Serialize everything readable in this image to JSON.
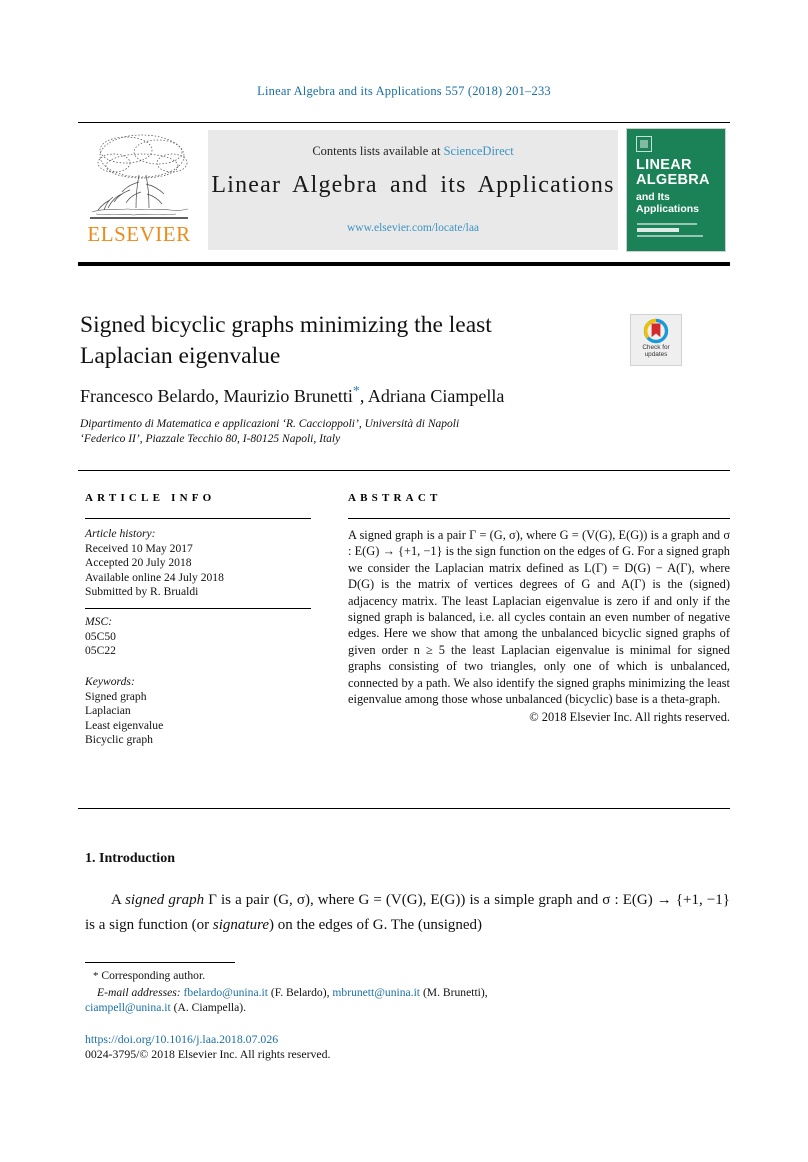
{
  "running_head": "Linear Algebra and its Applications 557 (2018) 201–233",
  "masthead": {
    "contents_prefix": "Contents lists available at ",
    "sciencedirect": "ScienceDirect",
    "journal_name": "Linear Algebra and its Applications",
    "journal_url": "www.elsevier.com/locate/laa",
    "publisher": "ELSEVIER",
    "cover": {
      "line1": "LINEAR",
      "line2": "ALGEBRA",
      "line3": "and Its",
      "line4": "Applications"
    }
  },
  "article": {
    "title": "Signed bicyclic graphs minimizing the least Laplacian eigenvalue",
    "authors": "Francesco Belardo, Maurizio Brunetti",
    "author_star": "*",
    "authors_tail": ", Adriana Ciampella",
    "affiliation_line1": "Dipartimento di Matematica e applicazioni ‘R. Caccioppoli’, Università di Napoli",
    "affiliation_line2": "‘Federico II’, Piazzale Tecchio 80, I-80125 Napoli, Italy",
    "crossmark_label_line1": "Check for",
    "crossmark_label_line2": "updates"
  },
  "info": {
    "heading": "ARTICLE INFO",
    "history_label": "Article history:",
    "history": [
      "Received 10 May 2017",
      "Accepted 20 July 2018",
      "Available online 24 July 2018",
      "Submitted by R. Brualdi"
    ],
    "msc_label": "MSC:",
    "msc": [
      "05C50",
      "05C22"
    ],
    "keywords_label": "Keywords:",
    "keywords": [
      "Signed graph",
      "Laplacian",
      "Least eigenvalue",
      "Bicyclic graph"
    ]
  },
  "abstract": {
    "heading": "ABSTRACT",
    "text": "A signed graph is a pair Γ = (G, σ), where G = (V(G), E(G)) is a graph and σ : E(G) → {+1, −1} is the sign function on the edges of G. For a signed graph we consider the Laplacian matrix defined as L(Γ) = D(G) − A(Γ), where D(G) is the matrix of vertices degrees of G and A(Γ) is the (signed) adjacency matrix. The least Laplacian eigenvalue is zero if and only if the signed graph is balanced, i.e. all cycles contain an even number of negative edges. Here we show that among the unbalanced bicyclic signed graphs of given order n ≥ 5 the least Laplacian eigenvalue is minimal for signed graphs consisting of two triangles, only one of which is unbalanced, connected by a path. We also identify the signed graphs minimizing the least eigenvalue among those whose unbalanced (bicyclic) base is a theta-graph.",
    "copyright": "© 2018 Elsevier Inc. All rights reserved."
  },
  "body": {
    "section_title": "1. Introduction",
    "paragraph_part1": "A ",
    "paragraph_italic1": "signed graph",
    "paragraph_part2": " Γ is a pair (G, σ), where G = (V(G), E(G)) is a simple graph and σ : E(G) → {+1, −1} is a sign function (or ",
    "paragraph_italic2": "signature",
    "paragraph_part3": ") on the edges of G. The (unsigned)"
  },
  "footer": {
    "corresponding_star": "*",
    "corresponding_text": "Corresponding author.",
    "email_label": "E-mail addresses:",
    "emails": [
      {
        "address": "fbelardo@unina.it",
        "name": "(F. Belardo),"
      },
      {
        "address": "mbrunett@unina.it",
        "name": "(M. Brunetti),"
      },
      {
        "address": "ciampell@unina.it",
        "name": "(A. Ciampella)."
      }
    ],
    "doi": "https://doi.org/10.1016/j.laa.2018.07.026",
    "issn_line": "0024-3795/© 2018 Elsevier Inc. All rights reserved."
  },
  "colors": {
    "link": "#1a6fa3",
    "sciencedirect": "#3c93c2",
    "elsevier_orange": "#ea8c1c",
    "cover_green": "#1b8257"
  }
}
